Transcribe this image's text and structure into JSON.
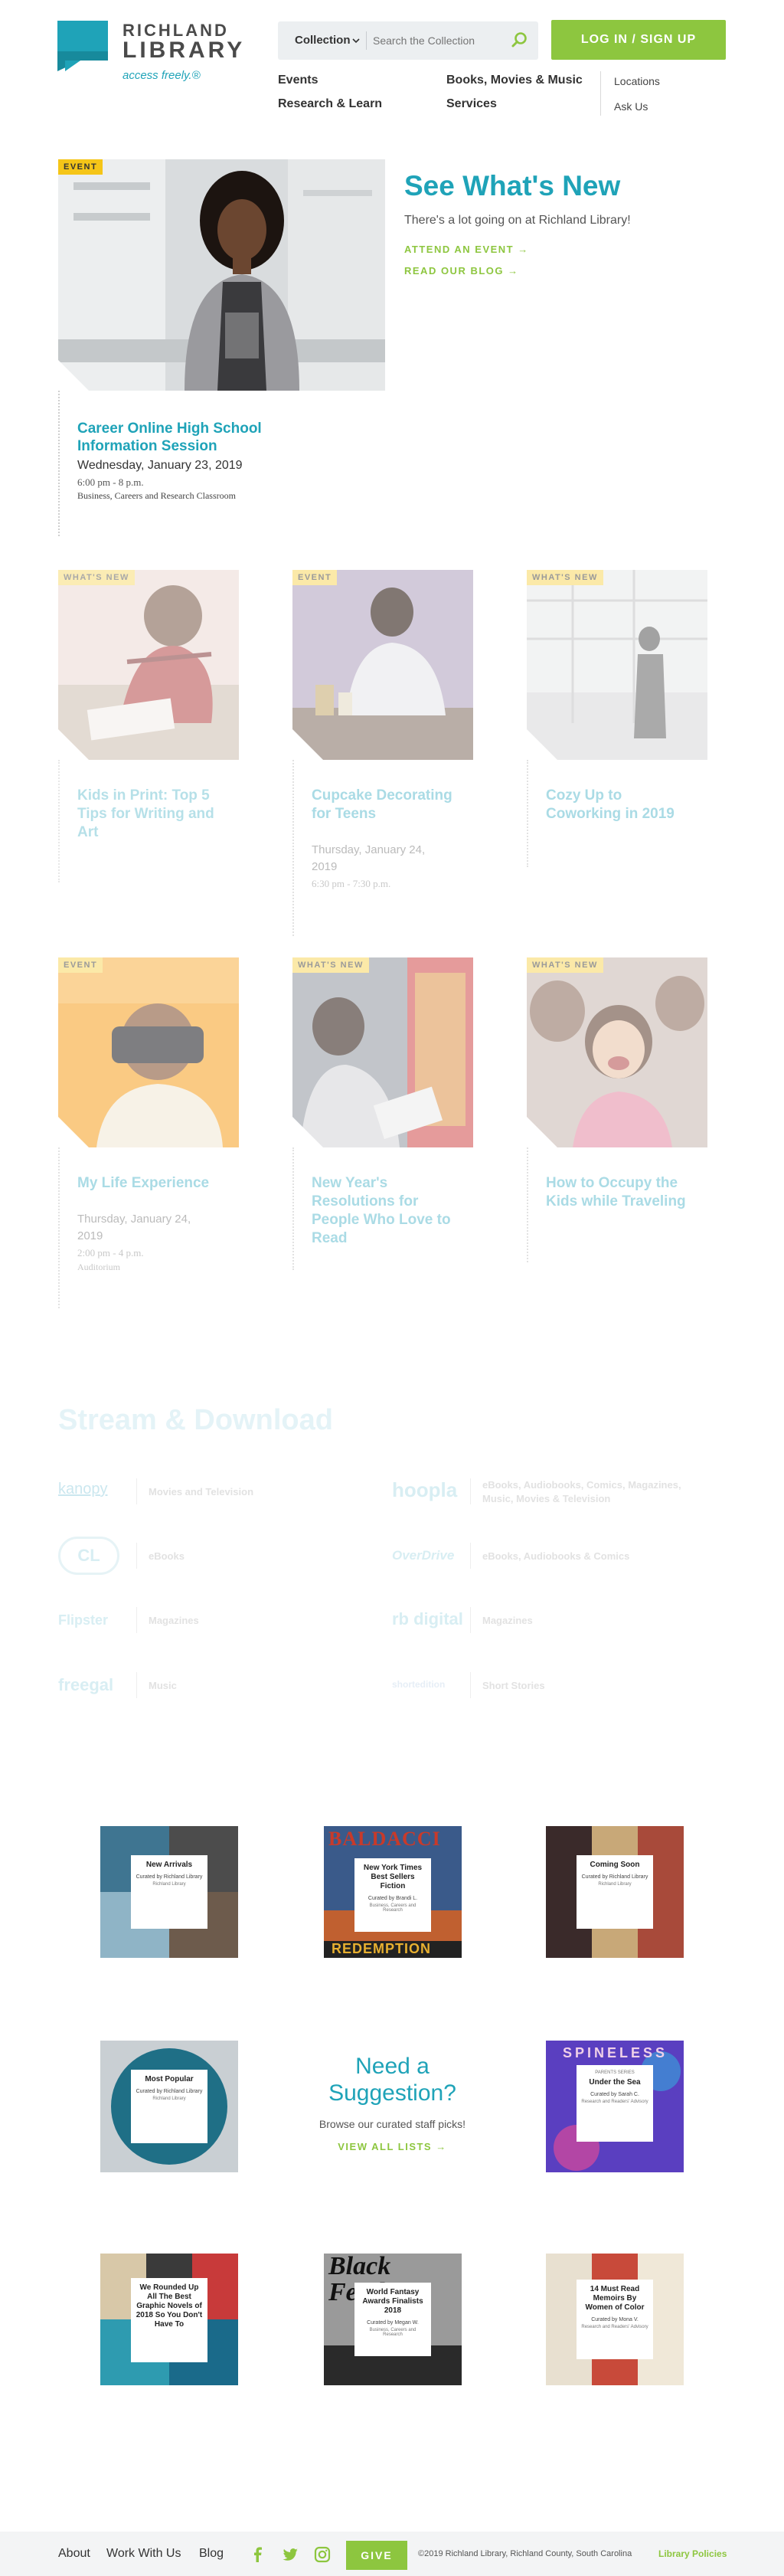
{
  "header": {
    "logo_line1": "RICHLAND",
    "logo_line2": "LIBRARY",
    "tagline": "access freely.®",
    "search_select": "Collection",
    "search_placeholder": "Search the Collection",
    "login_label": "LOG IN / SIGN UP",
    "nav": [
      "Events",
      "Books, Movies & Music",
      "Research & Learn",
      "Services"
    ],
    "nav_secondary": [
      "Locations",
      "Ask Us"
    ]
  },
  "featured": {
    "badge": "EVENT",
    "title": "Career Online High School Information Session",
    "date": "Wednesday, January 23, 2019",
    "time": "6:00 pm - 8 p.m.",
    "location": "Business, Careers and Research Classroom"
  },
  "whats_new": {
    "title": "See What's New",
    "subtitle": "There's a lot going on at Richland Library!",
    "link1": "ATTEND AN EVENT →",
    "link2": "READ OUR BLOG →"
  },
  "cards": [
    {
      "badge": "WHAT'S NEW",
      "title": "Kids in Print: Top 5 Tips for Writing and Art",
      "date": "",
      "time": "",
      "location": ""
    },
    {
      "badge": "EVENT",
      "title": "Cupcake Decorating for Teens",
      "date": "Thursday, January 24, 2019",
      "time": "6:30 pm - 7:30 p.m.",
      "location": ""
    },
    {
      "badge": "WHAT'S NEW",
      "title": "Cozy Up to Coworking in 2019",
      "date": "",
      "time": "",
      "location": ""
    },
    {
      "badge": "EVENT",
      "title": "My Life Experience",
      "date": "Thursday, January 24, 2019",
      "time": "2:00 pm - 4 p.m.",
      "location": "Auditorium"
    },
    {
      "badge": "WHAT'S NEW",
      "title": "New Year's Resolutions for People Who Love to Read",
      "date": "",
      "time": "",
      "location": ""
    },
    {
      "badge": "WHAT'S NEW",
      "title": "How to Occupy the Kids while Traveling",
      "date": "",
      "time": "",
      "location": ""
    }
  ],
  "stream": {
    "title": "Stream & Download",
    "services": [
      {
        "logo": "kanopy",
        "desc": "Movies and Television"
      },
      {
        "logo": "hoopla",
        "desc": "eBooks, Audiobooks, Comics, Magazines, Music, Movies & Television"
      },
      {
        "logo": "CL",
        "desc": "eBooks"
      },
      {
        "logo": "OverDrive",
        "desc": "eBooks, Audiobooks & Comics"
      },
      {
        "logo": "Flipster",
        "desc": "Magazines"
      },
      {
        "logo": "rb digital",
        "desc": "Magazines"
      },
      {
        "logo": "freegal",
        "desc": "Music"
      },
      {
        "logo": "shortedition",
        "desc": "Short Stories"
      }
    ]
  },
  "lists": [
    {
      "title": "New Arrivals",
      "curator": "Curated by Richland Library",
      "group": "Richland Library",
      "bg": "#5b8fa8"
    },
    {
      "title": "New York Times Best Sellers Fiction",
      "curator": "Curated by Brandi L.",
      "group": "Business, Careers and Research",
      "bg": "#7a3d2a",
      "cover": "BALDACCI",
      "cover_bottom": "REDEMPTION"
    },
    {
      "title": "Coming Soon",
      "curator": "Curated by Richland Library",
      "group": "Richland Library",
      "bg": "#8a6a4a"
    },
    {
      "title": "Most Popular",
      "curator": "Curated by Richland Library",
      "group": "Richland Library",
      "bg": "#c9cfd3"
    },
    {
      "title": "Under the Sea",
      "curator": "Curated by Sarah C.",
      "group": "Research and Readers' Advisory",
      "bg": "#4a4fb8",
      "kicker": "PARENTS SERIES",
      "cover": "SPINELESS"
    },
    {
      "title": "We Rounded Up All The Best Graphic Novels of 2018 So You Don't Have To",
      "curator": "",
      "group": "",
      "bg": "#2e9bb0"
    },
    {
      "title": "World Fantasy Awards Finalists 2018",
      "curator": "Curated by Megan W.",
      "group": "Business, Careers and Research",
      "bg": "#555555",
      "cover": "Black Feathers"
    },
    {
      "title": "14 Must Read Memoirs By Women of Color",
      "curator": "Curated by Mona V.",
      "group": "Research and Readers' Advisory",
      "bg": "#b89a6a"
    }
  ],
  "suggestion": {
    "title": "Need a Suggestion?",
    "subtitle": "Browse our curated staff picks!",
    "link": "VIEW ALL LISTS →"
  },
  "footer": {
    "links": [
      "About",
      "Work With Us",
      "Blog"
    ],
    "give": "GIVE",
    "copyright": "©2019 Richland Library, Richland County, South Carolina",
    "policies": "Library Policies"
  },
  "colors": {
    "teal": "#1fa3b8",
    "green": "#8dc63f",
    "badge_yellow": "#f5c518"
  }
}
